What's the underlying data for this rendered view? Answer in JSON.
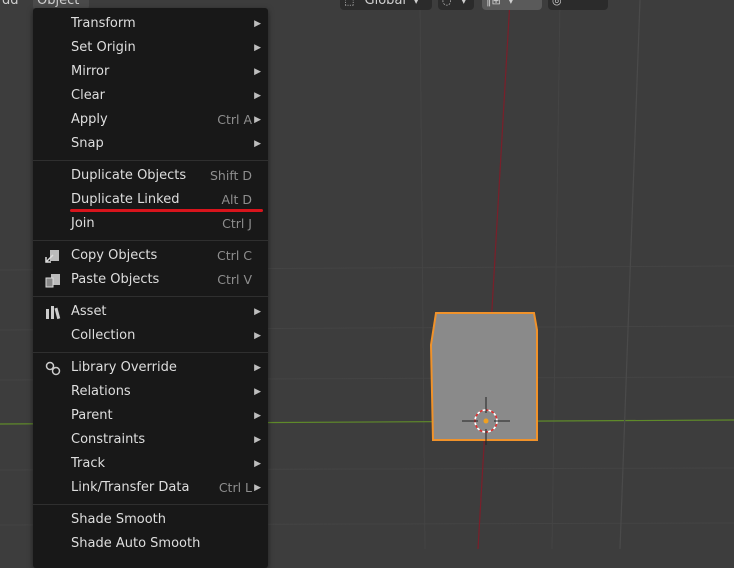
{
  "header": {
    "menus": [
      "dd",
      "Object"
    ],
    "orientation_value": "Global",
    "pivot_icon": "pivot-icon",
    "snap_icon": "snap-icon",
    "proportional_icon": "proportional-edit-icon"
  },
  "menu": {
    "items": [
      {
        "label": "Transform",
        "shortcut": "",
        "submenu": true,
        "icon": ""
      },
      {
        "label": "Set Origin",
        "shortcut": "",
        "submenu": true,
        "icon": ""
      },
      {
        "label": "Mirror",
        "shortcut": "",
        "submenu": true,
        "icon": ""
      },
      {
        "label": "Clear",
        "shortcut": "",
        "submenu": true,
        "icon": ""
      },
      {
        "label": "Apply",
        "shortcut": "Ctrl A",
        "submenu": true,
        "icon": ""
      },
      {
        "label": "Snap",
        "shortcut": "",
        "submenu": true,
        "icon": ""
      },
      {
        "label": "Duplicate Objects",
        "shortcut": "Shift D",
        "submenu": false,
        "icon": ""
      },
      {
        "label": "Duplicate Linked",
        "shortcut": "Alt D",
        "submenu": false,
        "icon": ""
      },
      {
        "label": "Join",
        "shortcut": "Ctrl J",
        "submenu": false,
        "icon": ""
      },
      {
        "label": "Copy Objects",
        "shortcut": "Ctrl C",
        "submenu": false,
        "icon": "copy-icon"
      },
      {
        "label": "Paste Objects",
        "shortcut": "Ctrl V",
        "submenu": false,
        "icon": "paste-icon"
      },
      {
        "label": "Asset",
        "shortcut": "",
        "submenu": true,
        "icon": "asset-icon"
      },
      {
        "label": "Collection",
        "shortcut": "",
        "submenu": true,
        "icon": ""
      },
      {
        "label": "Library Override",
        "shortcut": "",
        "submenu": true,
        "icon": "library-override-icon"
      },
      {
        "label": "Relations",
        "shortcut": "",
        "submenu": true,
        "icon": ""
      },
      {
        "label": "Parent",
        "shortcut": "",
        "submenu": true,
        "icon": ""
      },
      {
        "label": "Constraints",
        "shortcut": "",
        "submenu": true,
        "icon": ""
      },
      {
        "label": "Track",
        "shortcut": "",
        "submenu": true,
        "icon": ""
      },
      {
        "label": "Link/Transfer Data",
        "shortcut": "Ctrl L",
        "submenu": true,
        "icon": ""
      },
      {
        "label": "Shade Smooth",
        "shortcut": "",
        "submenu": false,
        "icon": ""
      },
      {
        "label": "Shade Auto Smooth",
        "shortcut": "",
        "submenu": false,
        "icon": ""
      }
    ]
  },
  "colors": {
    "viewport_bg": "#3d3d3d",
    "menu_bg": "#181818",
    "selection_outline": "#f0922a",
    "x_axis": "#7a1f2a",
    "y_axis": "#5f8a2a",
    "annotation_underline": "#d8141c"
  }
}
